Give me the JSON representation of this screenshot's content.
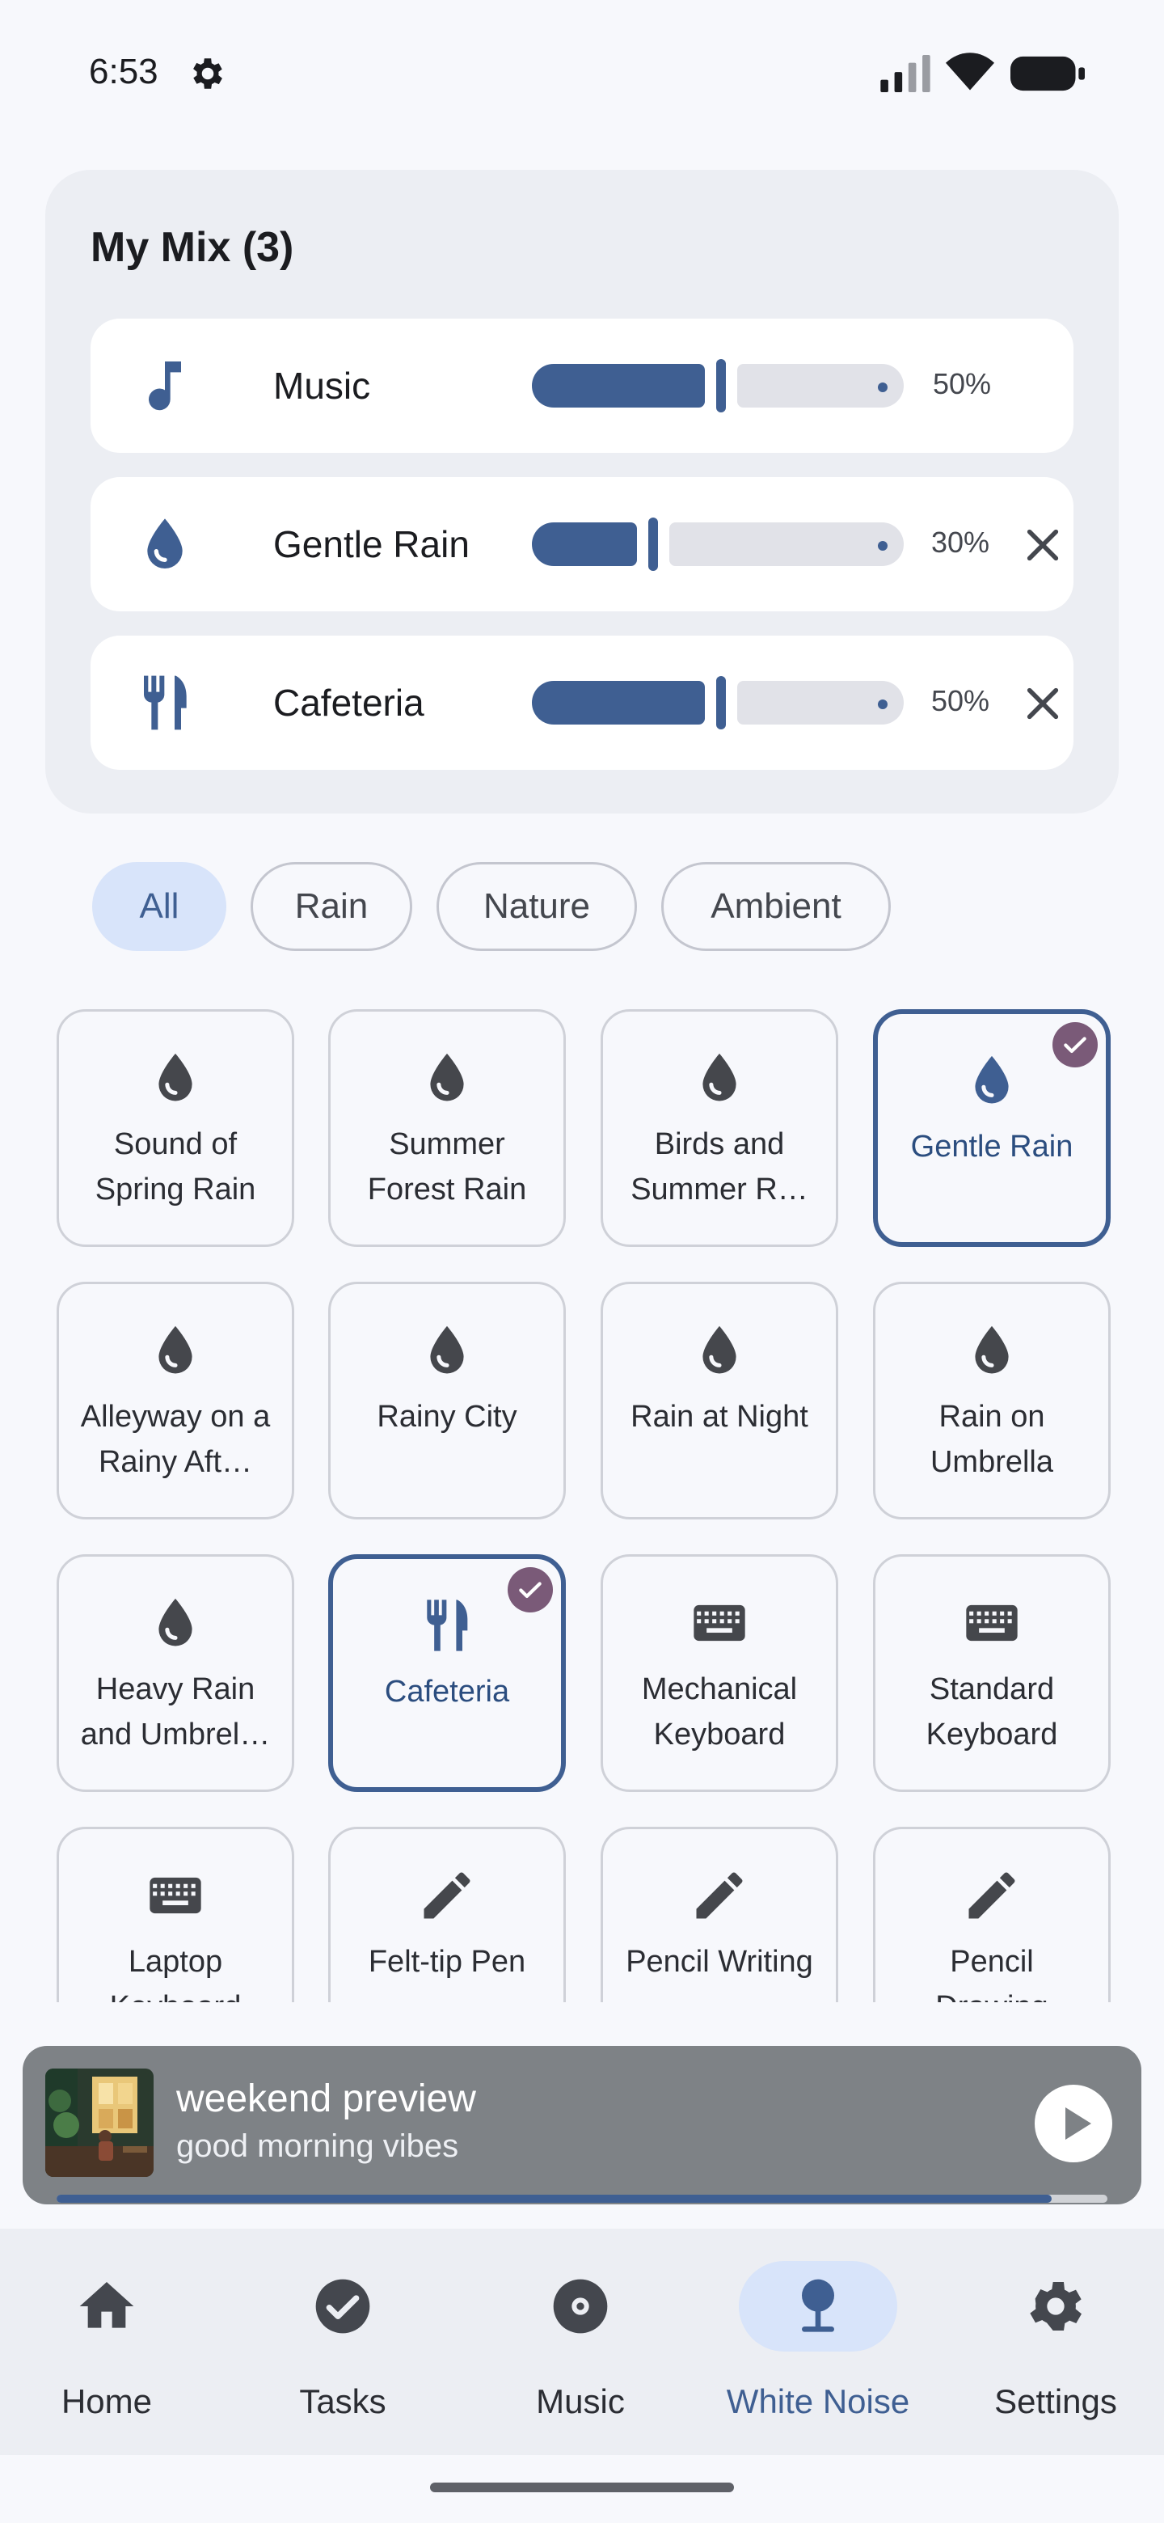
{
  "status_bar": {
    "time": "6:53",
    "icons": [
      "gear-icon",
      "signal-icon",
      "wifi-icon",
      "battery-icon"
    ]
  },
  "mix": {
    "title": "My Mix (3)",
    "items": [
      {
        "label": "Music",
        "icon": "music-note-icon",
        "percent_label": "50%",
        "volume": 0.5,
        "removable": false
      },
      {
        "label": "Gentle Rain",
        "icon": "water-drop-icon",
        "percent_label": "30%",
        "volume": 0.3,
        "removable": true
      },
      {
        "label": "Cafeteria",
        "icon": "restaurant-icon",
        "percent_label": "50%",
        "volume": 0.5,
        "removable": true
      }
    ]
  },
  "filters": {
    "chips": [
      "All",
      "Rain",
      "Nature",
      "Ambient"
    ],
    "selected": "All"
  },
  "sounds": [
    {
      "label": "Sound of Spring Rain",
      "icon": "water-drop-icon",
      "selected": false
    },
    {
      "label": "Summer Forest Rain",
      "icon": "water-drop-icon",
      "selected": false
    },
    {
      "label": "Birds and Summer R…",
      "icon": "water-drop-icon",
      "selected": false
    },
    {
      "label": "Gentle Rain",
      "icon": "water-drop-icon",
      "selected": true
    },
    {
      "label": "Alleyway on a Rainy Aft…",
      "icon": "water-drop-icon",
      "selected": false
    },
    {
      "label": "Rainy City",
      "icon": "water-drop-icon",
      "selected": false
    },
    {
      "label": "Rain at Night",
      "icon": "water-drop-icon",
      "selected": false
    },
    {
      "label": "Rain on Umbrella",
      "icon": "water-drop-icon",
      "selected": false
    },
    {
      "label": "Heavy Rain and Umbrel…",
      "icon": "water-drop-icon",
      "selected": false
    },
    {
      "label": "Cafeteria",
      "icon": "restaurant-icon",
      "selected": true
    },
    {
      "label": "Mechanical Keyboard",
      "icon": "keyboard-icon",
      "selected": false
    },
    {
      "label": "Standard Keyboard",
      "icon": "keyboard-icon",
      "selected": false
    },
    {
      "label": "Laptop Keyboard",
      "icon": "keyboard-icon",
      "selected": false
    },
    {
      "label": "Felt-tip Pen",
      "icon": "pencil-icon",
      "selected": false
    },
    {
      "label": "Pencil Writing",
      "icon": "pencil-icon",
      "selected": false
    },
    {
      "label": "Pencil Drawing",
      "icon": "pencil-icon",
      "selected": false
    }
  ],
  "player": {
    "title": "weekend preview",
    "subtitle": "good morning vibes",
    "progress": 0.947
  },
  "nav": {
    "items": [
      {
        "label": "Home",
        "icon": "home-icon"
      },
      {
        "label": "Tasks",
        "icon": "check-circle-icon"
      },
      {
        "label": "Music",
        "icon": "disc-icon"
      },
      {
        "label": "White Noise",
        "icon": "white-noise-icon"
      },
      {
        "label": "Settings",
        "icon": "gear-icon"
      }
    ],
    "active": "White Noise"
  },
  "colors": {
    "accent": "#3f5f92",
    "accent_container": "#d8e4fa",
    "check_badge": "#7a5a78",
    "player_bg": "#7e8286"
  }
}
